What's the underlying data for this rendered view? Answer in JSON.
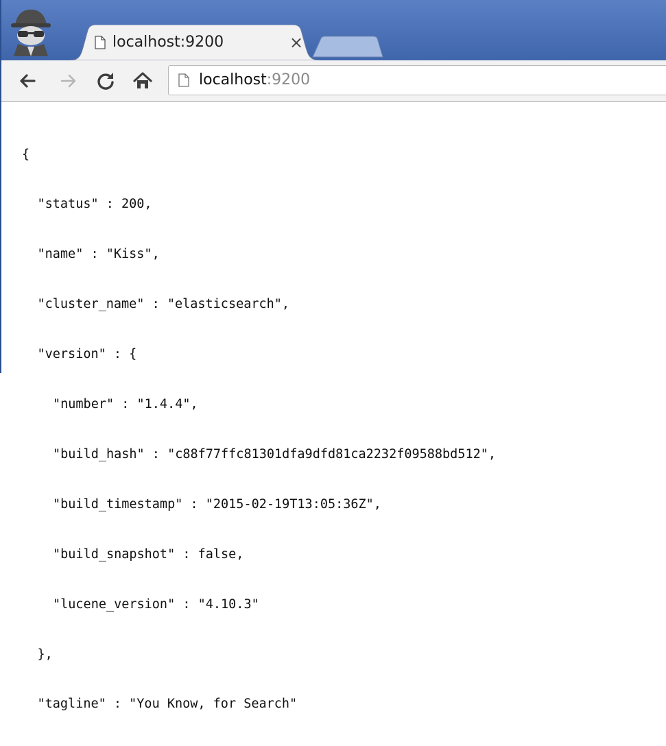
{
  "browser": {
    "incognito_icon": "incognito-spy-icon",
    "tab": {
      "favicon": "page-icon",
      "title": "localhost:9200",
      "close_glyph": "×"
    },
    "toolbar": {
      "back_icon": "arrow-left-icon",
      "forward_icon": "arrow-right-icon",
      "reload_icon": "reload-icon",
      "home_icon": "home-icon",
      "url_host": "localhost",
      "url_port": ":9200"
    },
    "colors": {
      "titlebar": "#4a70b5",
      "toolbar": "#f2f2f2",
      "url_port": "#8a8a8a"
    }
  },
  "json_lines": [
    "{",
    "\"status\" : 200,",
    "\"name\" : \"Kiss\",",
    "\"cluster_name\" : \"elasticsearch\",",
    "\"version\" : {",
    "\"number\" : \"1.4.4\",",
    "\"build_hash\" : \"c88f77ffc81301dfa9dfd81ca2232f09588bd512\",",
    "\"build_timestamp\" : \"2015-02-19T13:05:36Z\",",
    "\"build_snapshot\" : false,",
    "\"lucene_version\" : \"4.10.3\"",
    "},",
    "\"tagline\" : \"You Know, for Search\"",
    "}"
  ]
}
